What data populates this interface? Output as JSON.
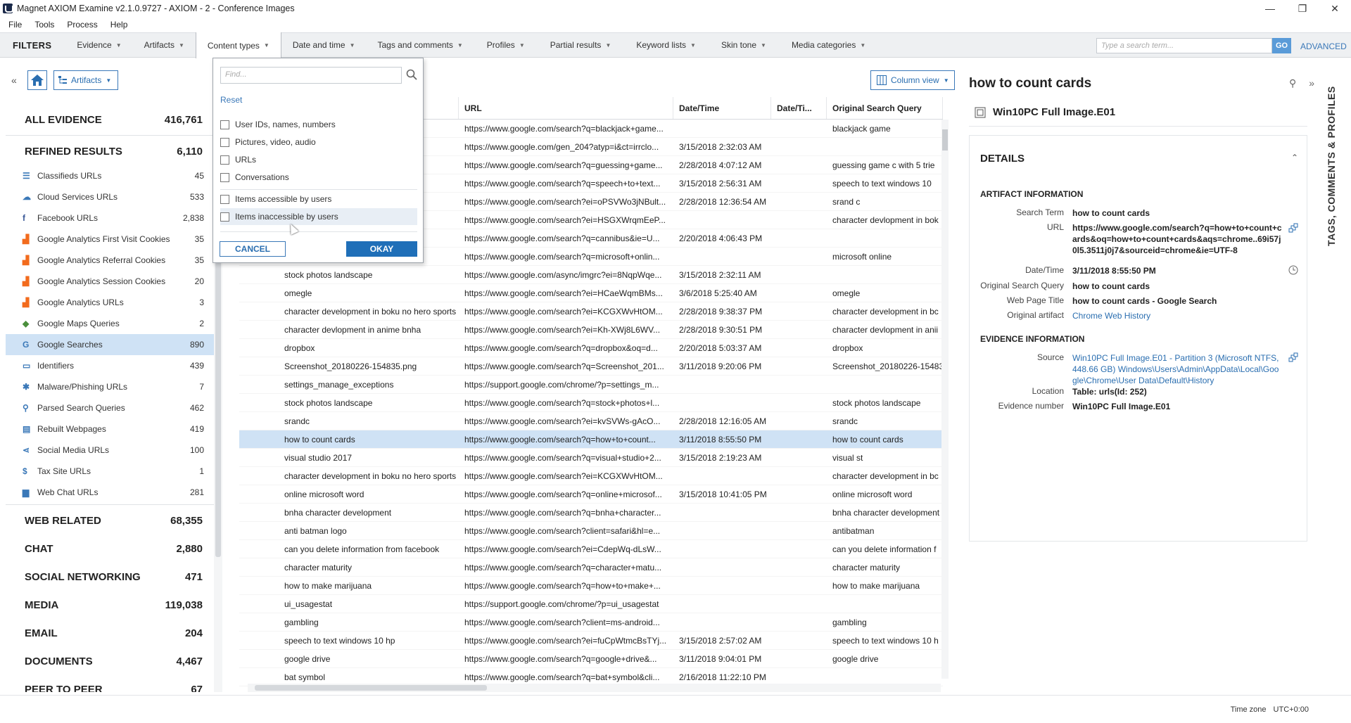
{
  "window": {
    "title": "Magnet AXIOM Examine v2.1.0.9727 - AXIOM - 2 - Conference Images",
    "controls": [
      "—",
      "❐",
      "✕"
    ]
  },
  "menu": [
    "File",
    "Tools",
    "Process",
    "Help"
  ],
  "filterbar": {
    "label": "FILTERS",
    "buttons": [
      "Evidence",
      "Artifacts",
      "Content types",
      "Date and time",
      "Tags and comments",
      "Profiles",
      "Partial results",
      "Keyword lists",
      "Skin tone",
      "Media categories"
    ],
    "search_placeholder": "Type a search term...",
    "go": "GO",
    "advanced": "ADVANCED"
  },
  "toolbar": {
    "artifacts_label": "Artifacts",
    "column_view": "Column view"
  },
  "sidebar": {
    "all_evidence": {
      "label": "ALL EVIDENCE",
      "count": "416,761"
    },
    "refined": {
      "label": "REFINED RESULTS",
      "count": "6,110"
    },
    "refined_items": [
      {
        "label": "Classifieds URLs",
        "count": "45",
        "icon": "list-icon",
        "color": "#3a78b8"
      },
      {
        "label": "Cloud Services URLs",
        "count": "533",
        "icon": "cloud-icon",
        "color": "#3a78b8"
      },
      {
        "label": "Facebook URLs",
        "count": "2,838",
        "icon": "facebook-icon",
        "color": "#3b5998"
      },
      {
        "label": "Google Analytics First Visit Cookies",
        "count": "35",
        "icon": "analytics-icon",
        "color": "#f26b1d"
      },
      {
        "label": "Google Analytics Referral Cookies",
        "count": "35",
        "icon": "analytics-icon",
        "color": "#f26b1d"
      },
      {
        "label": "Google Analytics Session Cookies",
        "count": "20",
        "icon": "analytics-icon",
        "color": "#f26b1d"
      },
      {
        "label": "Google Analytics URLs",
        "count": "3",
        "icon": "analytics-icon",
        "color": "#f26b1d"
      },
      {
        "label": "Google Maps Queries",
        "count": "2",
        "icon": "map-icon",
        "color": "#4a8f3c"
      },
      {
        "label": "Google Searches",
        "count": "890",
        "icon": "google-icon",
        "color": "#3a78b8"
      },
      {
        "label": "Identifiers",
        "count": "439",
        "icon": "id-card-icon",
        "color": "#3a78b8"
      },
      {
        "label": "Malware/Phishing URLs",
        "count": "7",
        "icon": "bug-icon",
        "color": "#3a78b8"
      },
      {
        "label": "Parsed Search Queries",
        "count": "462",
        "icon": "search-icon",
        "color": "#3a78b8"
      },
      {
        "label": "Rebuilt Webpages",
        "count": "419",
        "icon": "webpage-icon",
        "color": "#3a78b8"
      },
      {
        "label": "Social Media URLs",
        "count": "100",
        "icon": "share-icon",
        "color": "#3a78b8"
      },
      {
        "label": "Tax Site URLs",
        "count": "1",
        "icon": "dollar-icon",
        "color": "#3a78b8"
      },
      {
        "label": "Web Chat URLs",
        "count": "281",
        "icon": "chat-icon",
        "color": "#3a78b8"
      }
    ],
    "categories": [
      {
        "label": "WEB RELATED",
        "count": "68,355"
      },
      {
        "label": "CHAT",
        "count": "2,880"
      },
      {
        "label": "SOCIAL NETWORKING",
        "count": "471"
      },
      {
        "label": "MEDIA",
        "count": "119,038"
      },
      {
        "label": "EMAIL",
        "count": "204"
      },
      {
        "label": "DOCUMENTS",
        "count": "4,467"
      },
      {
        "label": "PEER TO PEER",
        "count": "67"
      }
    ]
  },
  "grid": {
    "headers": [
      "",
      "",
      "URL",
      "Date/Time",
      "Date/Ti...",
      "Original Search Query"
    ],
    "rows": [
      [
        "",
        "",
        "https://www.google.com/search?q=blackjack+game...",
        "",
        "",
        "blackjack game"
      ],
      [
        "",
        "",
        "https://www.google.com/gen_204?atyp=i&ct=irrclo...",
        "3/15/2018 2:32:03 AM",
        "",
        ""
      ],
      [
        "",
        "",
        "https://www.google.com/search?q=guessing+game...",
        "2/28/2018 4:07:12 AM",
        "",
        "guessing game c  with 5 trie"
      ],
      [
        "",
        "",
        "https://www.google.com/search?q=speech+to+text...",
        "3/15/2018 2:56:31 AM",
        "",
        "speech to text windows 10"
      ],
      [
        "",
        "",
        "https://www.google.com/search?ei=oPSVWo3jNBult...",
        "2/28/2018 12:36:54 AM",
        "",
        "srand c"
      ],
      [
        "",
        "o",
        "https://www.google.com/search?ei=HSGXWrqmEeP...",
        "",
        "",
        "character devlopment in bok"
      ],
      [
        "",
        "",
        "https://www.google.com/search?q=cannibus&ie=U...",
        "2/20/2018 4:06:43 PM",
        "",
        ""
      ],
      [
        "",
        "",
        "https://www.google.com/search?q=microsoft+onlin...",
        "",
        "",
        "microsoft online"
      ],
      [
        "",
        "stock photos landscape",
        "https://www.google.com/async/imgrc?ei=8NqpWqe...",
        "3/15/2018 2:32:11 AM",
        "",
        ""
      ],
      [
        "",
        "omegle",
        "https://www.google.com/search?ei=HCaeWqmBMs...",
        "3/6/2018 5:25:40 AM",
        "",
        "omegle"
      ],
      [
        "",
        "character development in boku no hero sports",
        "https://www.google.com/search?ei=KCGXWvHtOM...",
        "2/28/2018 9:38:37 PM",
        "",
        "character development in bc"
      ],
      [
        "",
        "character devlopment in anime bnha",
        "https://www.google.com/search?ei=Kh-XWj8L6WV...",
        "2/28/2018 9:30:51 PM",
        "",
        "character devlopment in anii"
      ],
      [
        "",
        "dropbox",
        "https://www.google.com/search?q=dropbox&oq=d...",
        "2/20/2018 5:03:37 AM",
        "",
        "dropbox"
      ],
      [
        "",
        "Screenshot_20180226-154835.png",
        "https://www.google.com/search?q=Screenshot_201...",
        "3/11/2018 9:20:06 PM",
        "",
        "Screenshot_20180226-15483"
      ],
      [
        "",
        "settings_manage_exceptions",
        "https://support.google.com/chrome/?p=settings_m...",
        "",
        "",
        ""
      ],
      [
        "",
        "stock photos landscape",
        "https://www.google.com/search?q=stock+photos+l...",
        "",
        "",
        "stock photos landscape"
      ],
      [
        "",
        "srandc",
        "https://www.google.com/search?ei=kvSVWs-gAcO...",
        "2/28/2018 12:16:05 AM",
        "",
        "srandc"
      ],
      [
        "",
        "how to count cards",
        "https://www.google.com/search?q=how+to+count...",
        "3/11/2018 8:55:50 PM",
        "",
        "how to count cards"
      ],
      [
        "",
        "visual studio 2017",
        "https://www.google.com/search?q=visual+studio+2...",
        "3/15/2018 2:19:23 AM",
        "",
        "visual st"
      ],
      [
        "",
        "character development in boku no hero sports",
        "https://www.google.com/search?ei=KCGXWvHtOM...",
        "",
        "",
        "character development in bc"
      ],
      [
        "",
        "online microsoft word",
        "https://www.google.com/search?q=online+microsof...",
        "3/15/2018 10:41:05 PM",
        "",
        "online microsoft word"
      ],
      [
        "",
        "bnha character development",
        "https://www.google.com/search?q=bnha+character...",
        "",
        "",
        "bnha character development"
      ],
      [
        "",
        "anti batman logo",
        "https://www.google.com/search?client=safari&hl=e...",
        "",
        "",
        "antibatman"
      ],
      [
        "",
        "can you delete information from facebook",
        "https://www.google.com/search?ei=CdepWq-dLsW...",
        "",
        "",
        "can you delete information f"
      ],
      [
        "",
        "character maturity",
        "https://www.google.com/search?q=character+matu...",
        "",
        "",
        "character maturity"
      ],
      [
        "",
        "how to make marijuana",
        "https://www.google.com/search?q=how+to+make+...",
        "",
        "",
        "how to make marijuana"
      ],
      [
        "",
        "ui_usagestat",
        "https://support.google.com/chrome/?p=ui_usagestat",
        "",
        "",
        ""
      ],
      [
        "",
        "gambling",
        "https://www.google.com/search?client=ms-android...",
        "",
        "",
        "gambling"
      ],
      [
        "",
        "speech to text windows 10 hp",
        "https://www.google.com/search?ei=fuCpWtmcBsTYj...",
        "3/15/2018 2:57:02 AM",
        "",
        "speech to text windows 10 h"
      ],
      [
        "",
        "google drive",
        "https://www.google.com/search?q=google+drive&...",
        "3/11/2018 9:04:01 PM",
        "",
        "google drive"
      ],
      [
        "",
        "bat symbol",
        "https://www.google.com/search?q=bat+symbol&cli...",
        "2/16/2018 11:22:10 PM",
        "",
        ""
      ]
    ]
  },
  "content_types_dropdown": {
    "find_placeholder": "Find...",
    "reset": "Reset",
    "options": [
      "User IDs, names, numbers",
      "Pictures, video, audio",
      "URLs",
      "Conversations",
      "Items accessible by users",
      "Items inaccessible by users"
    ],
    "cancel": "CANCEL",
    "okay": "OKAY"
  },
  "details": {
    "title": "how to count cards",
    "source": "Win10PC Full Image.E01",
    "section": "DETAILS",
    "artifact_info_label": "ARTIFACT INFORMATION",
    "artifact_rows": [
      {
        "label": "Search Term",
        "value": "how to count cards"
      },
      {
        "label": "URL",
        "value": "https://www.google.com/search?q=how+to+count+cards&oq=how+to+count+cards&aqs=chrome..69i57j0l5.3511j0j7&sourceid=chrome&ie=UTF-8"
      },
      {
        "label": "Date/Time",
        "value": "3/11/2018 8:55:50 PM"
      },
      {
        "label": "Original Search Query",
        "value": "how to count cards"
      },
      {
        "label": "Web Page Title",
        "value": "how to count cards - Google Search"
      },
      {
        "label": "Original artifact",
        "value": "Chrome Web History"
      }
    ],
    "evidence_info_label": "EVIDENCE INFORMATION",
    "evidence_rows": [
      {
        "label": "Source",
        "value": "Win10PC Full Image.E01 - Partition 3 (Microsoft NTFS, 448.66 GB) Windows\\Users\\Admin\\AppData\\Local\\Google\\Chrome\\User Data\\Default\\History"
      },
      {
        "label": "Location",
        "value": "Table: urls(Id: 252)"
      },
      {
        "label": "Evidence number",
        "value": "Win10PC Full Image.E01"
      }
    ]
  },
  "right_strip": {
    "label": "TAGS, COMMENTS & PROFILES"
  },
  "status": {
    "tz_label": "Time zone",
    "tz_value": "UTC+0:00"
  },
  "colors": {
    "accent": "#3a78b8",
    "selected_row": "#cfe2f5",
    "okay_button": "#1f6fb8"
  }
}
